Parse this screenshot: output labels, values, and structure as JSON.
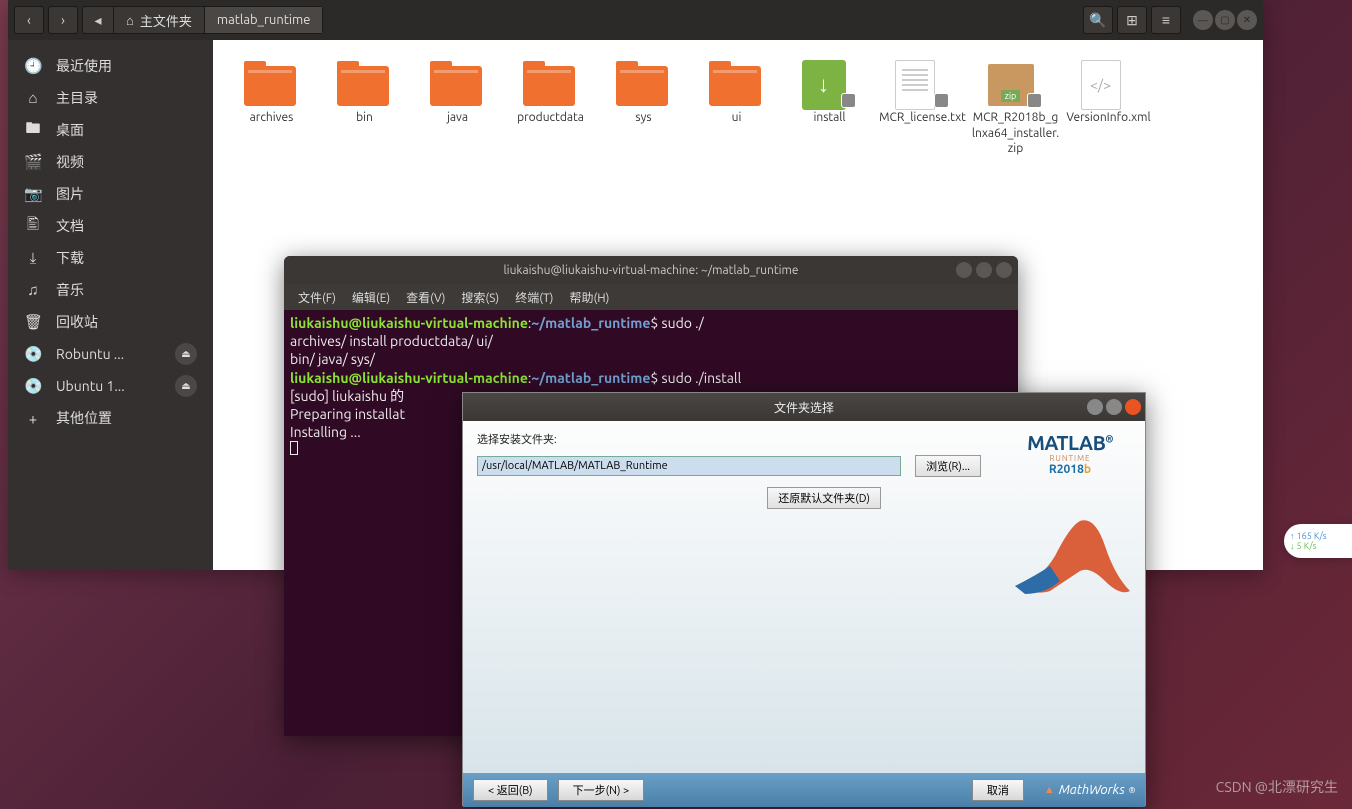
{
  "files": {
    "breadcrumb": {
      "home": "主文件夹",
      "folder": "matlab_runtime"
    },
    "sidebar": [
      {
        "icon": "🕘",
        "label": "最近使用"
      },
      {
        "icon": "⌂",
        "label": "主目录"
      },
      {
        "icon": "🖿",
        "label": "桌面"
      },
      {
        "icon": "🎬",
        "label": "视频"
      },
      {
        "icon": "📷",
        "label": "图片"
      },
      {
        "icon": "🖺",
        "label": "文档"
      },
      {
        "icon": "⤓",
        "label": "下载"
      },
      {
        "icon": "♫",
        "label": "音乐"
      },
      {
        "icon": "🗑",
        "label": "回收站"
      },
      {
        "icon": "💿",
        "label": "Robuntu ...",
        "eject": true
      },
      {
        "icon": "💿",
        "label": "Ubuntu 1...",
        "eject": true
      },
      {
        "icon": "+",
        "label": "其他位置"
      }
    ],
    "items": [
      {
        "type": "folder",
        "name": "archives"
      },
      {
        "type": "folder",
        "name": "bin"
      },
      {
        "type": "folder",
        "name": "java"
      },
      {
        "type": "folder",
        "name": "productdata"
      },
      {
        "type": "folder",
        "name": "sys"
      },
      {
        "type": "folder",
        "name": "ui"
      },
      {
        "type": "script",
        "name": "install",
        "lock": true
      },
      {
        "type": "doc",
        "name": "MCR_license.txt",
        "lock": true
      },
      {
        "type": "zip",
        "name": "MCR_R2018b_glnxa64_installer.zip",
        "lock": true
      },
      {
        "type": "xml",
        "name": "VersionInfo.xml"
      }
    ]
  },
  "terminal": {
    "title": "liukaishu@liukaishu-virtual-machine: ~/matlab_runtime",
    "menu": [
      "文件(F)",
      "编辑(E)",
      "查看(V)",
      "搜索(S)",
      "终端(T)",
      "帮助(H)"
    ],
    "prompt_user": "liukaishu@liukaishu-virtual-machine",
    "prompt_path": "~/matlab_runtime",
    "cmd1": "sudo ./",
    "tabrow1": "archives/     install       productdata/ ui/",
    "tabrow2": "bin/          java/         sys/",
    "cmd2": "sudo ./install",
    "out1": "[sudo] liukaishu 的",
    "out2": "Preparing installat",
    "out3": "Installing ..."
  },
  "installer": {
    "title": "文件夹选择",
    "select_label": "选择安装文件夹:",
    "path_value": "/usr/local/MATLAB/MATLAB_Runtime",
    "browse_btn": "浏览(R)...",
    "restore_btn": "还原默认文件夹(D)",
    "logo": "MATLAB",
    "runtime": "RUNTIME",
    "release_prefix": "R2018",
    "release_suffix": "b",
    "back_btn": "< 返回(B)",
    "next_btn": "下一步(N) >",
    "cancel_btn": "取消",
    "mathworks": "MathWorks"
  },
  "speed": {
    "up": "↑ 165 K/s",
    "down": "↓ 5  K/s"
  },
  "watermark": "CSDN @北漂研究生"
}
